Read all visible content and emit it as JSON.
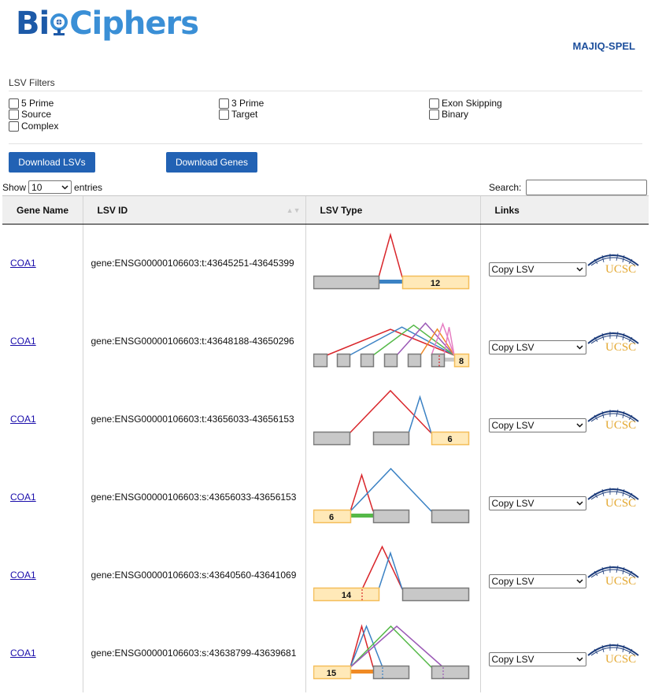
{
  "header": {
    "logo_text_bi": "Bi",
    "logo_text_ciphers": "Ciphers",
    "app_name": "MAJIQ-SPEL"
  },
  "filters": {
    "title": "LSV Filters",
    "options": [
      "5 Prime",
      "Source",
      "Complex",
      "3 Prime",
      "Target",
      "Exon Skipping",
      "Binary"
    ]
  },
  "buttons": {
    "download_lsvs": "Download LSVs",
    "download_genes": "Download Genes"
  },
  "length": {
    "show_label": "Show",
    "value": "10",
    "entries_label": "entries"
  },
  "search": {
    "label": "Search:",
    "value": ""
  },
  "table": {
    "columns": [
      "Gene Name",
      "LSV ID",
      "LSV Type",
      "Links"
    ],
    "rows": [
      {
        "gene": "COA1",
        "lsv_id": "gene:ENSG00000106603:t:43645251-43645399",
        "label": "12",
        "link": "Copy LSV"
      },
      {
        "gene": "COA1",
        "lsv_id": "gene:ENSG00000106603:t:43648188-43650296",
        "label": "8",
        "link": "Copy LSV"
      },
      {
        "gene": "COA1",
        "lsv_id": "gene:ENSG00000106603:t:43656033-43656153",
        "label": "6",
        "link": "Copy LSV"
      },
      {
        "gene": "COA1",
        "lsv_id": "gene:ENSG00000106603:s:43656033-43656153",
        "label": "6",
        "link": "Copy LSV"
      },
      {
        "gene": "COA1",
        "lsv_id": "gene:ENSG00000106603:s:43640560-43641069",
        "label": "14",
        "link": "Copy LSV"
      },
      {
        "gene": "COA1",
        "lsv_id": "gene:ENSG00000106603:s:43638799-43639681",
        "label": "15",
        "link": "Copy LSV"
      }
    ]
  },
  "ucsc_text": "UCSC",
  "colors": {
    "brand_dark": "#1d5aa8",
    "brand_light": "#3a8fd6",
    "button": "#2262b4",
    "exon_gray": "#c8c8c8",
    "exon_ref": "#ffe9b8",
    "exon_ref_border": "#f4be5a",
    "red": "#d9262b",
    "blue": "#3b82c4",
    "green": "#55b948",
    "purple": "#9b59b6",
    "orange": "#f08a24",
    "pink": "#e67ec2",
    "ucsc_gold": "#e3a72f",
    "ucsc_navy": "#1a3a7a"
  }
}
